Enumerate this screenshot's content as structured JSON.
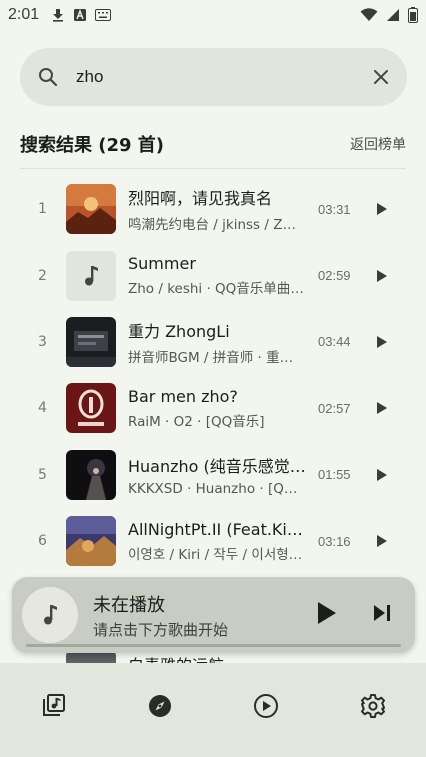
{
  "status_bar": {
    "time": "2:01",
    "icons": [
      "download-icon",
      "a-icon",
      "keyboard-icon",
      "wifi-icon",
      "signal-icon",
      "battery-icon"
    ]
  },
  "search": {
    "query": "zho",
    "icon": "search-icon",
    "clear_icon": "close-icon"
  },
  "results": {
    "title": "搜索结果 (29 首)",
    "back_label": "返回榜单",
    "items": [
      {
        "index": "1",
        "title": "烈阳啊，请见我真名",
        "subtitle": "鸣潮先约电台 / jkinss / Z…",
        "duration": "03:31"
      },
      {
        "index": "2",
        "title": "Summer",
        "subtitle": "Zho / keshi · QQ音乐单曲 …",
        "duration": "02:59"
      },
      {
        "index": "3",
        "title": "重力 ZhongLi",
        "subtitle": "拼音师BGM / 拼音师 · 重…",
        "duration": "03:44"
      },
      {
        "index": "4",
        "title": "Bar men zho?",
        "subtitle": "RaiM · O2 · [QQ音乐]",
        "duration": "02:57"
      },
      {
        "index": "5",
        "title": "Huanzho (纯音乐感觉…",
        "subtitle": "KKKXSD · Huanzho · [QQ…",
        "duration": "01:55"
      },
      {
        "index": "6",
        "title": "AllNightPt.II (Feat.Kir…",
        "subtitle": "이영호 / Kiri / 작두 / 이서형…",
        "duration": "03:16"
      }
    ],
    "partial_item_title": "白麦雅的远航"
  },
  "mini_player": {
    "title": "未在播放",
    "subtitle": "请点击下方歌曲开始"
  },
  "nav": {
    "items": [
      "library-icon",
      "discover-icon",
      "now-playing-icon",
      "settings-icon"
    ],
    "active": "discover-icon"
  },
  "colors": {
    "background": "#f3f6ef",
    "search_bg": "#e2e5dd",
    "mini_player_bg": "#c9ccc3",
    "nav_bg": "#e3e6dd"
  }
}
